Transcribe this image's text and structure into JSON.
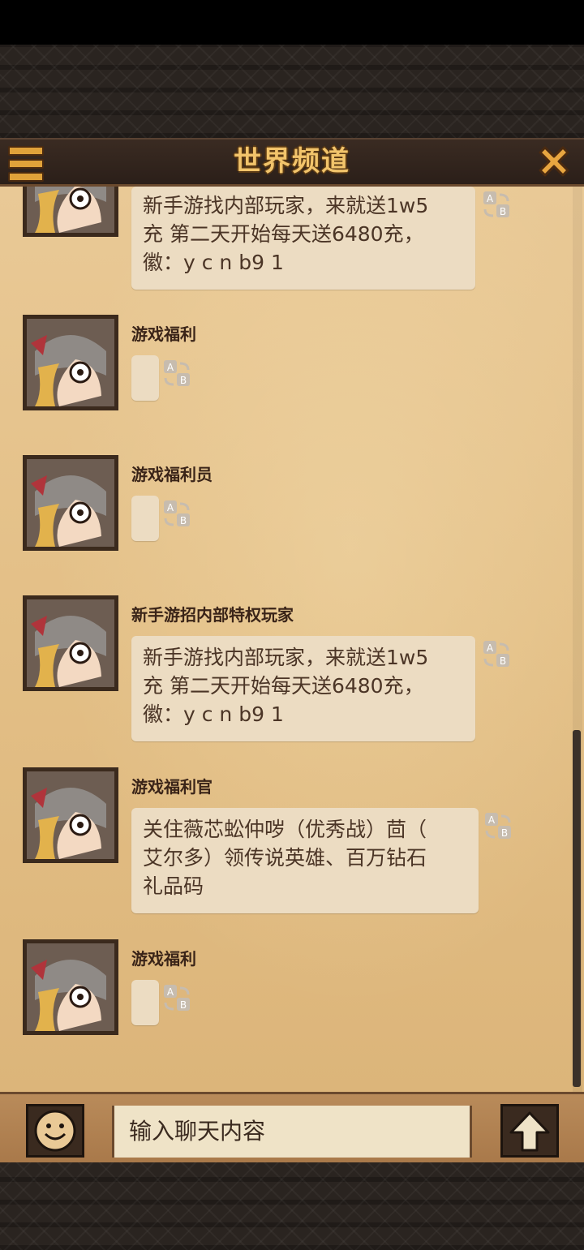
{
  "header": {
    "title": "世界频道"
  },
  "messages": [
    {
      "name": "",
      "text": "新手游找内部玩家，来就送1w5\n充 第二天开始每天送6480充，\n徽：y c n b9 1"
    },
    {
      "name": "游戏福利",
      "text": ""
    },
    {
      "name": "游戏福利员",
      "text": ""
    },
    {
      "name": "新手游招内部特权玩家",
      "text": "新手游找内部玩家，来就送1w5\n充 第二天开始每天送6480充，\n徽：y c n b9 1"
    },
    {
      "name": "游戏福利官",
      "text": "关住薇芯蚣仲哕（优秀战）茴（\n艾尔多）领传说英雄、百万钻石\n礼品码"
    },
    {
      "name": "游戏福利",
      "text": ""
    }
  ],
  "input": {
    "placeholder": "输入聊天内容"
  },
  "icons": {
    "menu": "menu-icon",
    "close": "close-icon",
    "emoji": "emoji-icon",
    "send": "send-arrow-icon",
    "translate": "translate-ab-icon"
  },
  "colors": {
    "title": "#f2c46b",
    "parchment": "#e3bf86",
    "bubble": "#ecdcc2"
  }
}
